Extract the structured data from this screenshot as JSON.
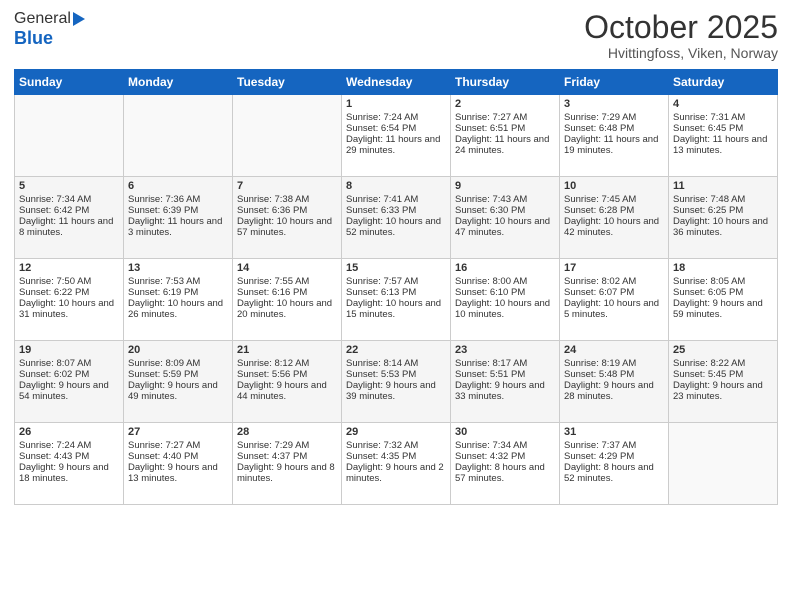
{
  "header": {
    "logo_general": "General",
    "logo_blue": "Blue",
    "month": "October 2025",
    "location": "Hvittingfoss, Viken, Norway"
  },
  "days_of_week": [
    "Sunday",
    "Monday",
    "Tuesday",
    "Wednesday",
    "Thursday",
    "Friday",
    "Saturday"
  ],
  "weeks": [
    [
      {
        "day": "",
        "sunrise": "",
        "sunset": "",
        "daylight": ""
      },
      {
        "day": "",
        "sunrise": "",
        "sunset": "",
        "daylight": ""
      },
      {
        "day": "",
        "sunrise": "",
        "sunset": "",
        "daylight": ""
      },
      {
        "day": "1",
        "sunrise": "Sunrise: 7:24 AM",
        "sunset": "Sunset: 6:54 PM",
        "daylight": "Daylight: 11 hours and 29 minutes."
      },
      {
        "day": "2",
        "sunrise": "Sunrise: 7:27 AM",
        "sunset": "Sunset: 6:51 PM",
        "daylight": "Daylight: 11 hours and 24 minutes."
      },
      {
        "day": "3",
        "sunrise": "Sunrise: 7:29 AM",
        "sunset": "Sunset: 6:48 PM",
        "daylight": "Daylight: 11 hours and 19 minutes."
      },
      {
        "day": "4",
        "sunrise": "Sunrise: 7:31 AM",
        "sunset": "Sunset: 6:45 PM",
        "daylight": "Daylight: 11 hours and 13 minutes."
      }
    ],
    [
      {
        "day": "5",
        "sunrise": "Sunrise: 7:34 AM",
        "sunset": "Sunset: 6:42 PM",
        "daylight": "Daylight: 11 hours and 8 minutes."
      },
      {
        "day": "6",
        "sunrise": "Sunrise: 7:36 AM",
        "sunset": "Sunset: 6:39 PM",
        "daylight": "Daylight: 11 hours and 3 minutes."
      },
      {
        "day": "7",
        "sunrise": "Sunrise: 7:38 AM",
        "sunset": "Sunset: 6:36 PM",
        "daylight": "Daylight: 10 hours and 57 minutes."
      },
      {
        "day": "8",
        "sunrise": "Sunrise: 7:41 AM",
        "sunset": "Sunset: 6:33 PM",
        "daylight": "Daylight: 10 hours and 52 minutes."
      },
      {
        "day": "9",
        "sunrise": "Sunrise: 7:43 AM",
        "sunset": "Sunset: 6:30 PM",
        "daylight": "Daylight: 10 hours and 47 minutes."
      },
      {
        "day": "10",
        "sunrise": "Sunrise: 7:45 AM",
        "sunset": "Sunset: 6:28 PM",
        "daylight": "Daylight: 10 hours and 42 minutes."
      },
      {
        "day": "11",
        "sunrise": "Sunrise: 7:48 AM",
        "sunset": "Sunset: 6:25 PM",
        "daylight": "Daylight: 10 hours and 36 minutes."
      }
    ],
    [
      {
        "day": "12",
        "sunrise": "Sunrise: 7:50 AM",
        "sunset": "Sunset: 6:22 PM",
        "daylight": "Daylight: 10 hours and 31 minutes."
      },
      {
        "day": "13",
        "sunrise": "Sunrise: 7:53 AM",
        "sunset": "Sunset: 6:19 PM",
        "daylight": "Daylight: 10 hours and 26 minutes."
      },
      {
        "day": "14",
        "sunrise": "Sunrise: 7:55 AM",
        "sunset": "Sunset: 6:16 PM",
        "daylight": "Daylight: 10 hours and 20 minutes."
      },
      {
        "day": "15",
        "sunrise": "Sunrise: 7:57 AM",
        "sunset": "Sunset: 6:13 PM",
        "daylight": "Daylight: 10 hours and 15 minutes."
      },
      {
        "day": "16",
        "sunrise": "Sunrise: 8:00 AM",
        "sunset": "Sunset: 6:10 PM",
        "daylight": "Daylight: 10 hours and 10 minutes."
      },
      {
        "day": "17",
        "sunrise": "Sunrise: 8:02 AM",
        "sunset": "Sunset: 6:07 PM",
        "daylight": "Daylight: 10 hours and 5 minutes."
      },
      {
        "day": "18",
        "sunrise": "Sunrise: 8:05 AM",
        "sunset": "Sunset: 6:05 PM",
        "daylight": "Daylight: 9 hours and 59 minutes."
      }
    ],
    [
      {
        "day": "19",
        "sunrise": "Sunrise: 8:07 AM",
        "sunset": "Sunset: 6:02 PM",
        "daylight": "Daylight: 9 hours and 54 minutes."
      },
      {
        "day": "20",
        "sunrise": "Sunrise: 8:09 AM",
        "sunset": "Sunset: 5:59 PM",
        "daylight": "Daylight: 9 hours and 49 minutes."
      },
      {
        "day": "21",
        "sunrise": "Sunrise: 8:12 AM",
        "sunset": "Sunset: 5:56 PM",
        "daylight": "Daylight: 9 hours and 44 minutes."
      },
      {
        "day": "22",
        "sunrise": "Sunrise: 8:14 AM",
        "sunset": "Sunset: 5:53 PM",
        "daylight": "Daylight: 9 hours and 39 minutes."
      },
      {
        "day": "23",
        "sunrise": "Sunrise: 8:17 AM",
        "sunset": "Sunset: 5:51 PM",
        "daylight": "Daylight: 9 hours and 33 minutes."
      },
      {
        "day": "24",
        "sunrise": "Sunrise: 8:19 AM",
        "sunset": "Sunset: 5:48 PM",
        "daylight": "Daylight: 9 hours and 28 minutes."
      },
      {
        "day": "25",
        "sunrise": "Sunrise: 8:22 AM",
        "sunset": "Sunset: 5:45 PM",
        "daylight": "Daylight: 9 hours and 23 minutes."
      }
    ],
    [
      {
        "day": "26",
        "sunrise": "Sunrise: 7:24 AM",
        "sunset": "Sunset: 4:43 PM",
        "daylight": "Daylight: 9 hours and 18 minutes."
      },
      {
        "day": "27",
        "sunrise": "Sunrise: 7:27 AM",
        "sunset": "Sunset: 4:40 PM",
        "daylight": "Daylight: 9 hours and 13 minutes."
      },
      {
        "day": "28",
        "sunrise": "Sunrise: 7:29 AM",
        "sunset": "Sunset: 4:37 PM",
        "daylight": "Daylight: 9 hours and 8 minutes."
      },
      {
        "day": "29",
        "sunrise": "Sunrise: 7:32 AM",
        "sunset": "Sunset: 4:35 PM",
        "daylight": "Daylight: 9 hours and 2 minutes."
      },
      {
        "day": "30",
        "sunrise": "Sunrise: 7:34 AM",
        "sunset": "Sunset: 4:32 PM",
        "daylight": "Daylight: 8 hours and 57 minutes."
      },
      {
        "day": "31",
        "sunrise": "Sunrise: 7:37 AM",
        "sunset": "Sunset: 4:29 PM",
        "daylight": "Daylight: 8 hours and 52 minutes."
      },
      {
        "day": "",
        "sunrise": "",
        "sunset": "",
        "daylight": ""
      }
    ]
  ]
}
